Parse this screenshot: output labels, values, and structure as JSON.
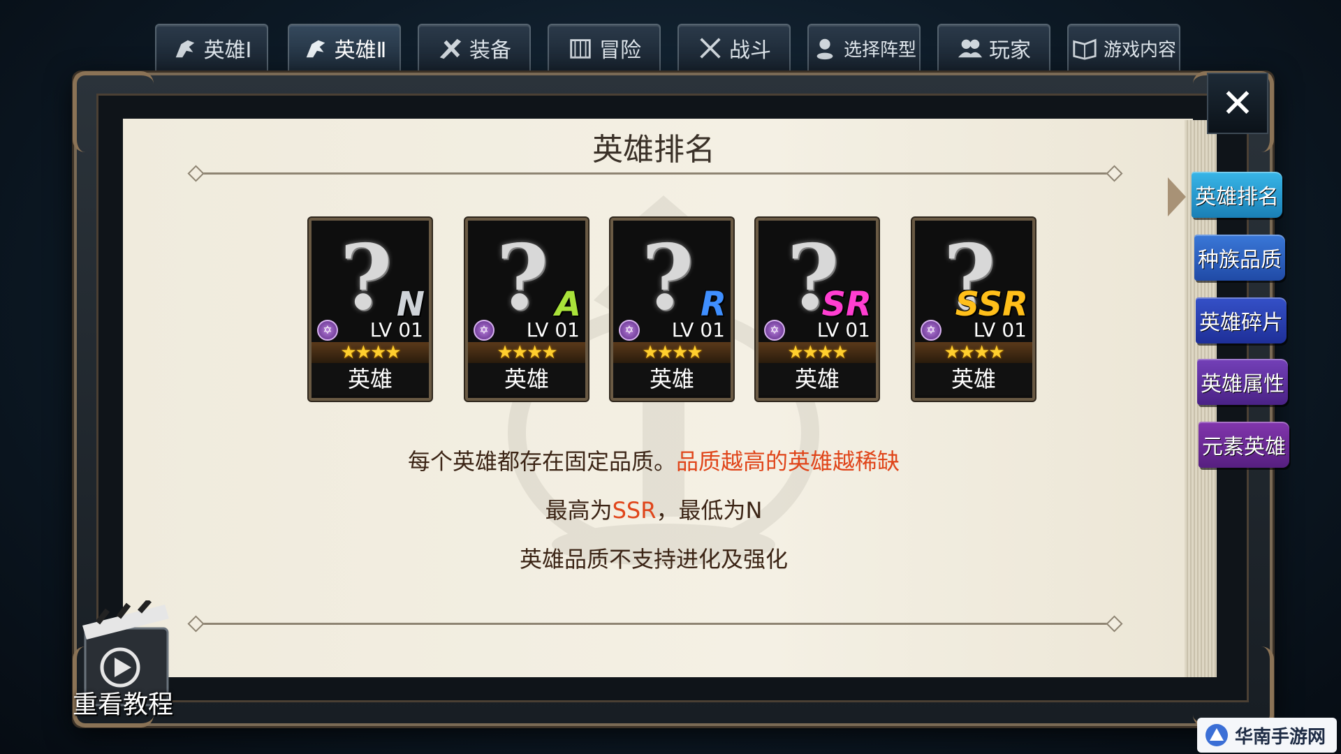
{
  "top_tabs": [
    {
      "label": "英雄Ⅰ",
      "icon": "hero-icon"
    },
    {
      "label": "英雄Ⅱ",
      "icon": "hero-icon"
    },
    {
      "label": "装备",
      "icon": "equipment-icon"
    },
    {
      "label": "冒险",
      "icon": "adventure-icon"
    },
    {
      "label": "战斗",
      "icon": "crossed-swords-icon"
    },
    {
      "label": "选择阵型",
      "icon": "formation-icon"
    },
    {
      "label": "玩家",
      "icon": "players-icon"
    },
    {
      "label": "游戏内容",
      "icon": "book-icon"
    }
  ],
  "active_tab": "英雄Ⅱ",
  "page": {
    "title": "英雄排名",
    "cards": [
      {
        "grade": "N",
        "grade_color": "#cfd3d8",
        "level": "LV 01",
        "name": "英雄",
        "stars": "★★★★"
      },
      {
        "grade": "A",
        "grade_color": "#a9e23a",
        "level": "LV 01",
        "name": "英雄",
        "stars": "★★★★"
      },
      {
        "grade": "R",
        "grade_color": "#3f8fff",
        "level": "LV 01",
        "name": "英雄",
        "stars": "★★★★"
      },
      {
        "grade": "SR",
        "grade_color": "#ff3ed1",
        "level": "LV 01",
        "name": "英雄",
        "stars": "★★★★"
      },
      {
        "grade": "SSR",
        "grade_color": "#ffbf1a",
        "level": "LV 01",
        "name": "英雄",
        "stars": "★★★★"
      }
    ],
    "desc_line1_a": "每个英雄都存在固定品质。",
    "desc_line1_b": "品质越高的英雄越稀缺",
    "desc_line2_a": "最高为",
    "desc_line2_b": "SSR",
    "desc_line2_c": "，最低为N",
    "desc_line3": "英雄品质不支持进化及强化"
  },
  "side_menu": [
    {
      "label": "英雄排名",
      "color": "#1f8fc7",
      "active": true
    },
    {
      "label": "种族品质",
      "color": "#2c5fc0",
      "active": false
    },
    {
      "label": "英雄碎片",
      "color": "#2a3fb0",
      "active": false
    },
    {
      "label": "英雄属性",
      "color": "#5a2e9e",
      "active": false
    },
    {
      "label": "元素英雄",
      "color": "#6a2a96",
      "active": false
    }
  ],
  "replay_label": "重看教程",
  "logo_text": "华南手游网"
}
